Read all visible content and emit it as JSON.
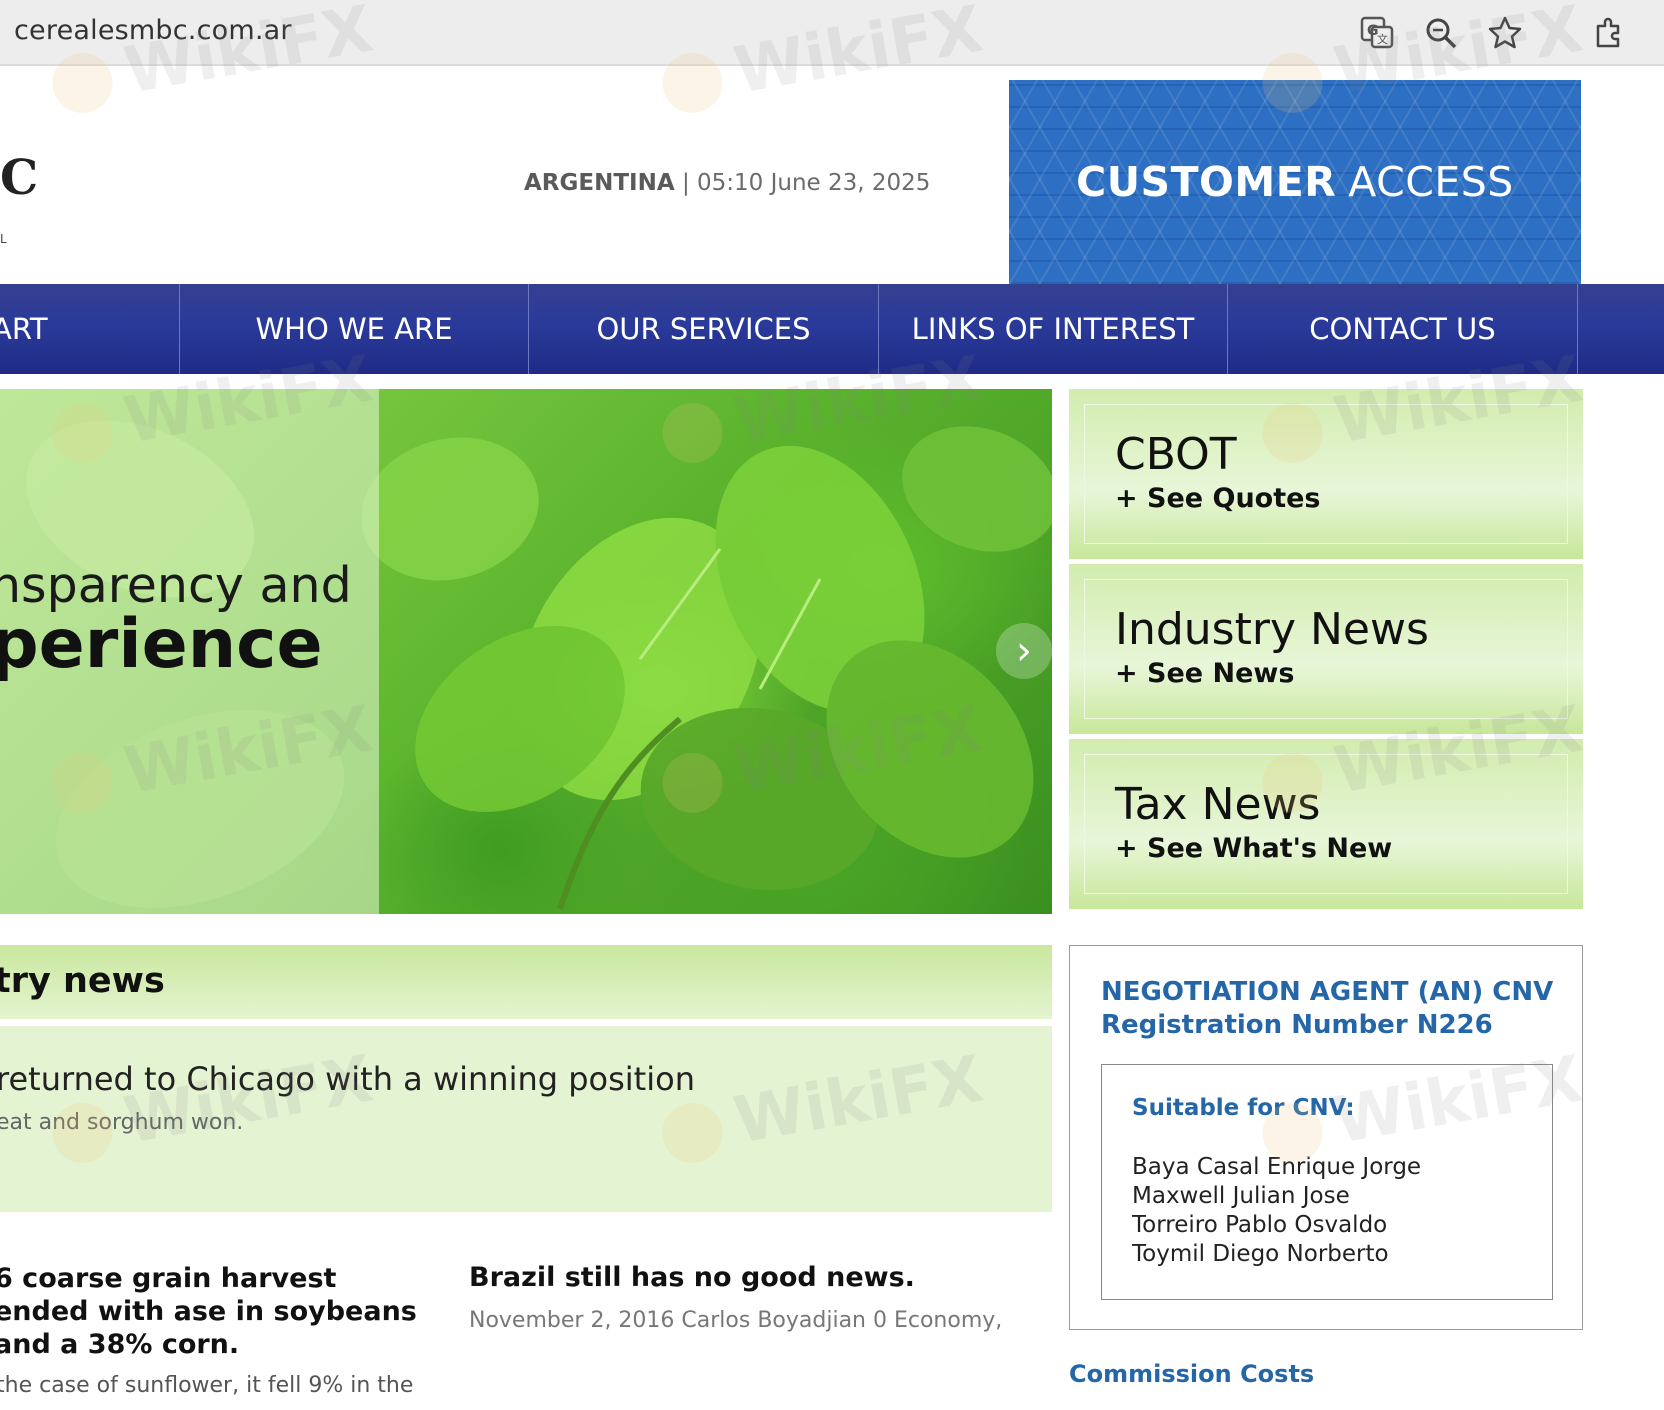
{
  "browser": {
    "url": "cerealesmbc.com.ar",
    "icons": [
      "translate-icon",
      "zoom-icon",
      "star-icon",
      "extensions-icon"
    ]
  },
  "header": {
    "logo_partial_top": "C",
    "logo_partial_bottom": "L",
    "country": "ARGENTINA",
    "separator": " | ",
    "datetime": "05:10 June 23, 2025",
    "customer_access": {
      "bold": "CUSTOMER",
      "normal": "ACCESS"
    }
  },
  "nav": {
    "items": [
      {
        "label": "ART"
      },
      {
        "label": "WHO WE ARE"
      },
      {
        "label": "OUR SERVICES"
      },
      {
        "label": "LINKS OF INTEREST"
      },
      {
        "label": "CONTACT US"
      }
    ]
  },
  "hero": {
    "line1": "nsparency and",
    "line2": "perience",
    "arrow": "›"
  },
  "side_boxes": [
    {
      "title": "CBOT",
      "subtitle": "+ See Quotes"
    },
    {
      "title": "Industry News",
      "subtitle": "+ See News"
    },
    {
      "title": "Tax News",
      "subtitle": "+ See What's New"
    }
  ],
  "news": {
    "section_title": "try news",
    "featured": {
      "headline": "returned to Chicago with a winning position",
      "excerpt": "eat and sorghum won."
    },
    "articles": [
      {
        "title": "6 coarse grain harvest ended with ase in soybeans and a 38% corn.",
        "excerpt": " the case of sunflower, it fell 9% in the"
      },
      {
        "title": "Brazil still has no good news.",
        "meta": "November 2, 2016 Carlos Boyadjian 0 Economy,"
      }
    ]
  },
  "cnv": {
    "heading_line1": "NEGOTIATION AGENT (AN) CNV",
    "heading_line2": "Registration Number N226",
    "suitable_label": "Suitable for CNV:",
    "names": [
      "Baya Casal Enrique Jorge",
      "Maxwell Julian Jose",
      "Torreiro Pablo Osvaldo",
      "Toymil Diego Norberto"
    ]
  },
  "commission_link": "Commission Costs",
  "watermark": "WikiFX"
}
